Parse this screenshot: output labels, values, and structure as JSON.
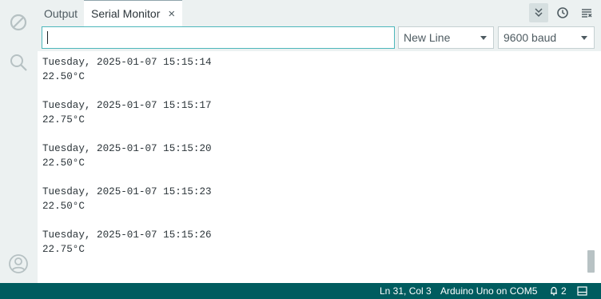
{
  "tabs": {
    "output_label": "Output",
    "serial_label": "Serial Monitor",
    "close_glyph": "×"
  },
  "toolbar": {
    "icons": [
      "autoscroll-icon",
      "timestamp-icon",
      "clear-output-icon"
    ]
  },
  "input": {
    "value": "",
    "placeholder": ""
  },
  "line_ending": {
    "selected": "New Line"
  },
  "baud": {
    "selected": "9600 baud"
  },
  "output_lines": [
    "Tuesday, 2025-01-07 15:15:14",
    "22.50°C",
    "",
    "Tuesday, 2025-01-07 15:15:17",
    "22.75°C",
    "",
    "Tuesday, 2025-01-07 15:15:20",
    "22.50°C",
    "",
    "Tuesday, 2025-01-07 15:15:23",
    "22.50°C",
    "",
    "Tuesday, 2025-01-07 15:15:26",
    "22.75°C"
  ],
  "status": {
    "position": "Ln 31, Col 3",
    "board": "Arduino Uno on COM5",
    "notifications": "2"
  },
  "colors": {
    "status_bar": "#005c5f",
    "input_focus": "#4db7bb",
    "sidebar_bg": "#ecf1f1"
  }
}
